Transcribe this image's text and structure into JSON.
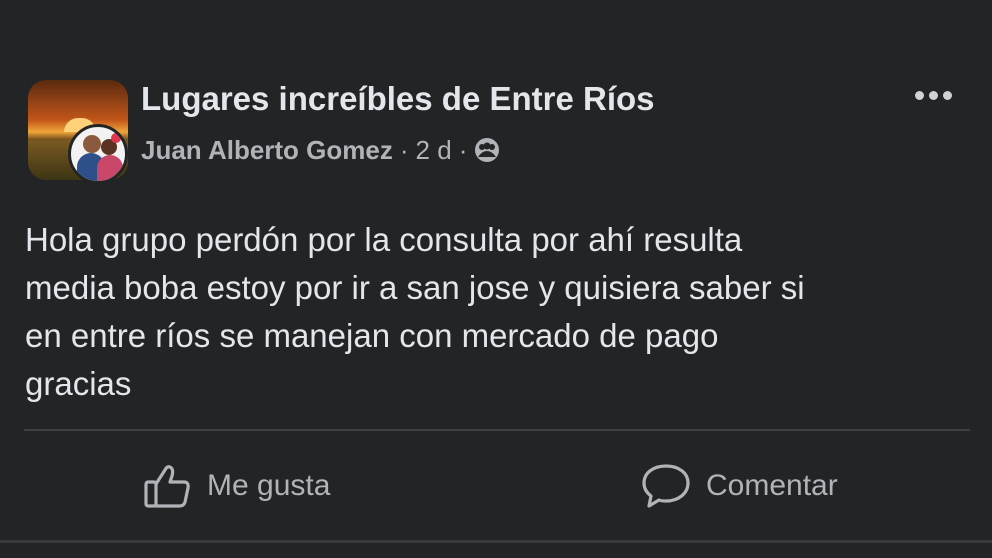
{
  "post": {
    "group_name": "Lugares increíbles de Entre Ríos",
    "author": "Juan Alberto Gomez",
    "separator": "·",
    "time": "2 d",
    "privacy_icon": "group-members-icon",
    "more_icon": "more-options-icon",
    "text_lines": [
      "Hola grupo perdón por la consulta por ahí resulta",
      "media boba estoy por ir a san jose y quisiera saber si",
      "en entre ríos se manejan con mercado de pago",
      "gracias"
    ]
  },
  "actions": {
    "like_label": "Me gusta",
    "like_icon": "thumbs-up-icon",
    "comment_label": "Comentar",
    "comment_icon": "speech-bubble-icon"
  },
  "colors": {
    "background": "#232426",
    "primary_text": "#e4e6eb",
    "secondary_text": "#b0b3b8",
    "divider": "#3e4042"
  }
}
